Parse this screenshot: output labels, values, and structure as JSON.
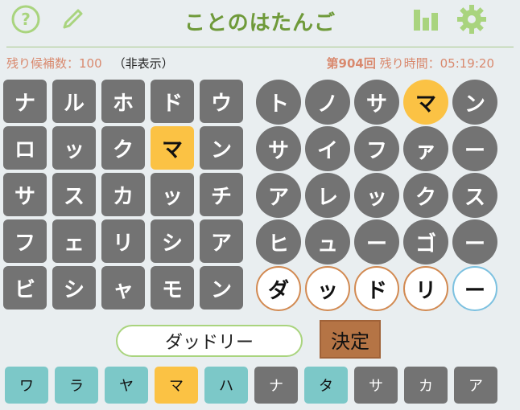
{
  "header": {
    "title": "ことのはたんご",
    "icons": [
      "help-icon",
      "pencil-icon",
      "stats-icon",
      "gear-icon"
    ],
    "accent_color": "#6f9a3a"
  },
  "status": {
    "remaining_candidates": "残り候補数：100",
    "hidden_label": "（非表示）",
    "round": "第904回",
    "time_left": "残り時間：05:19:20"
  },
  "square_board": {
    "rows": [
      [
        "ナ",
        "ル",
        "ホ",
        "ド",
        "ウ"
      ],
      [
        "ロ",
        "ッ",
        "ク",
        "マ",
        "ン"
      ],
      [
        "サ",
        "ス",
        "カ",
        "ッ",
        "チ"
      ],
      [
        "フ",
        "ェ",
        "リ",
        "シ",
        "ア"
      ],
      [
        "ビ",
        "シ",
        "ャ",
        "モ",
        "ン"
      ]
    ],
    "highlight": [
      [
        1,
        3
      ]
    ]
  },
  "circle_board": {
    "rows": [
      [
        "ト",
        "ノ",
        "サ",
        "マ",
        "ン"
      ],
      [
        "サ",
        "イ",
        "フ",
        "ァ",
        "ー"
      ],
      [
        "ア",
        "レ",
        "ッ",
        "ク",
        "ス"
      ],
      [
        "ヒ",
        "ュ",
        "ー",
        "ゴ",
        "ー"
      ],
      [
        "ダ",
        "ッ",
        "ド",
        "リ",
        "ー"
      ]
    ],
    "highlight": [
      [
        0,
        3
      ]
    ],
    "current_row": 4
  },
  "answer": {
    "value": "ダッドリー",
    "submit_label": "決定"
  },
  "kana_keys": [
    {
      "label": "ワ",
      "state": "used"
    },
    {
      "label": "ラ",
      "state": "used"
    },
    {
      "label": "ヤ",
      "state": "used"
    },
    {
      "label": "マ",
      "state": "found"
    },
    {
      "label": "ハ",
      "state": "used"
    },
    {
      "label": "ナ",
      "state": "unused"
    },
    {
      "label": "タ",
      "state": "used"
    },
    {
      "label": "サ",
      "state": "unused"
    },
    {
      "label": "カ",
      "state": "unused"
    },
    {
      "label": "ア",
      "state": "unused"
    }
  ],
  "colors": {
    "tile_gray": "#737373",
    "hit_yellow": "#fbc244",
    "used_teal": "#7cc8c8",
    "submit_brown": "#b57445"
  }
}
